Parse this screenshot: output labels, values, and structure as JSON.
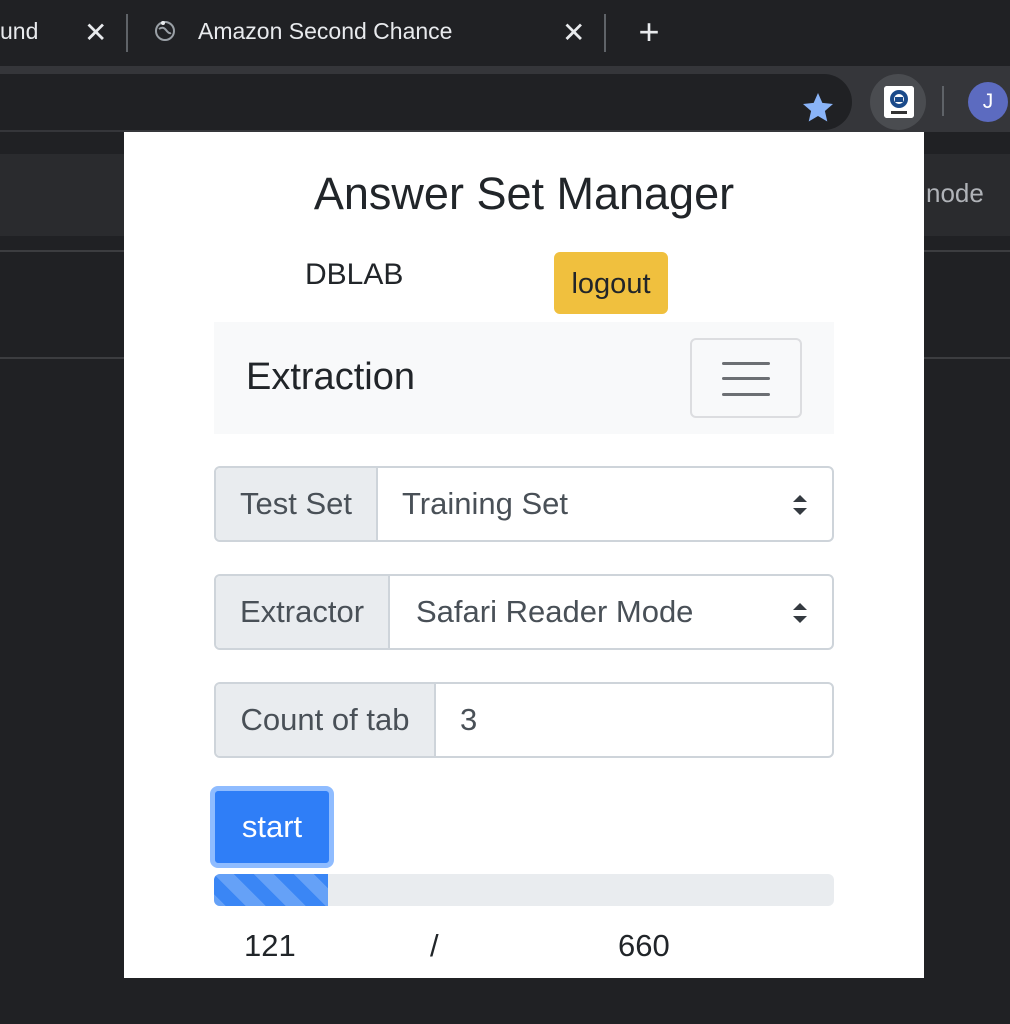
{
  "browser": {
    "tabs": [
      {
        "title": "und"
      },
      {
        "title": "Amazon Second Chance"
      }
    ],
    "close_glyph": "✕",
    "new_tab_glyph": "+",
    "profile_initial": "J",
    "background_text": "node"
  },
  "popup": {
    "title": "Answer Set Manager",
    "user": "DBLAB",
    "logout_label": "logout",
    "navbar": {
      "brand": "Extraction"
    },
    "test_set": {
      "label": "Test Set",
      "value": "Training Set"
    },
    "extractor": {
      "label": "Extractor",
      "value": "Safari Reader Mode"
    },
    "tab_count": {
      "label": "Count of tab",
      "value": "3"
    },
    "start_label": "start",
    "progress": {
      "current": "121",
      "separator": "/",
      "total": "660",
      "fraction": 0.1833
    }
  },
  "colors": {
    "accent": "#2f7ef7",
    "logout": "#f0c03e",
    "star": "#8ab4f8",
    "avatar": "#5c6bc0"
  },
  "icons": [
    "globe-icon",
    "star-icon",
    "dblab-extension-icon",
    "hamburger-icon",
    "select-arrows-icon"
  ]
}
